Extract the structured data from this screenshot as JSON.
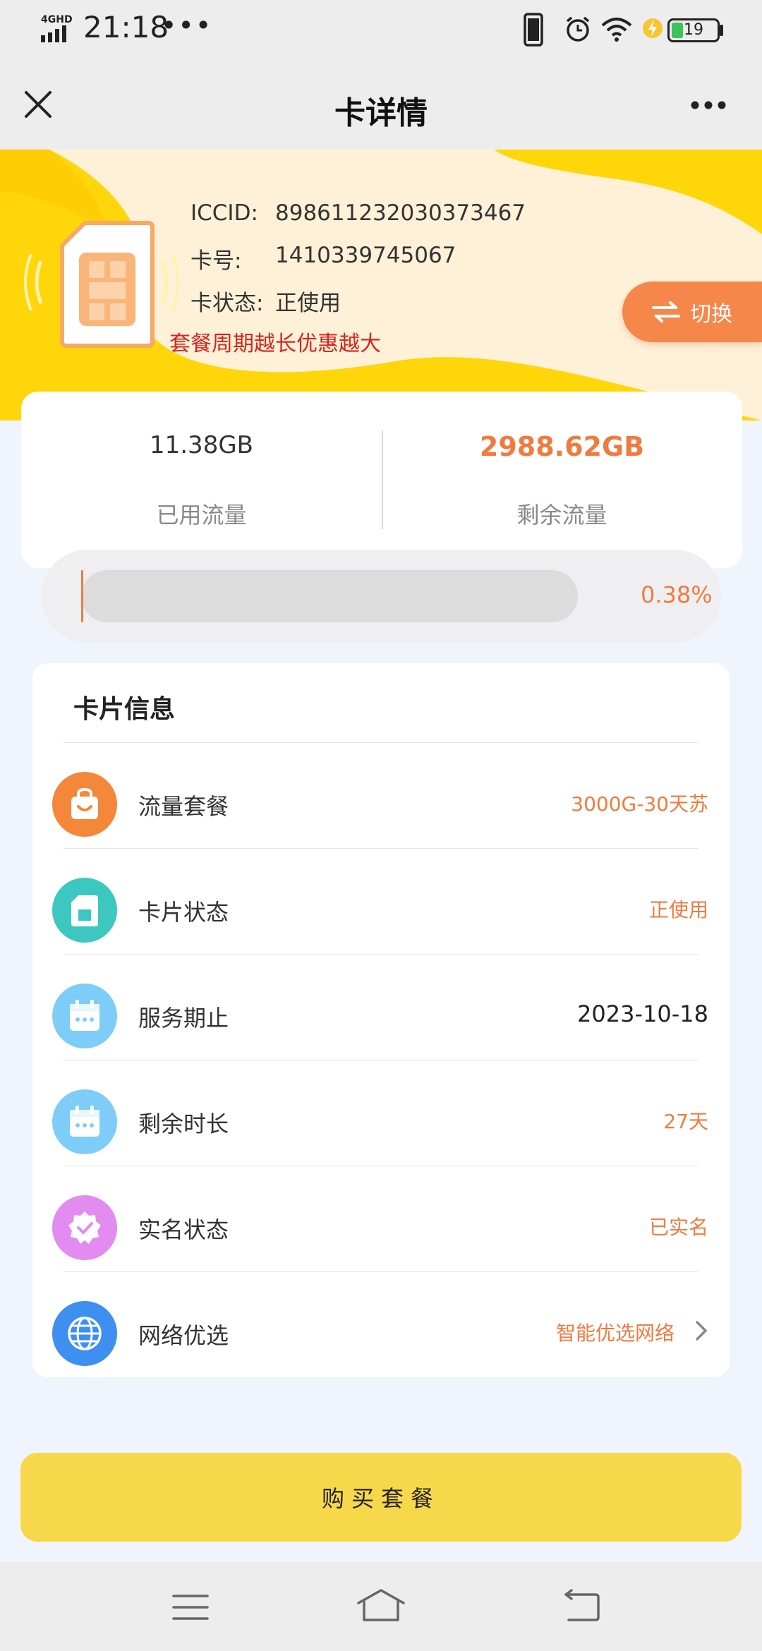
{
  "status_bar": {
    "network": "4GHD",
    "time": "21:18",
    "more": "•••",
    "battery": "19"
  },
  "nav": {
    "title": "卡详情"
  },
  "card": {
    "iccid_label": "ICCID:",
    "iccid": "898611232030373467",
    "number_label": "卡号:",
    "number": "1410339745067",
    "status_label": "卡状态:",
    "status": "正使用",
    "promo": "套餐周期越长优惠越大",
    "switch_label": "切换"
  },
  "usage": {
    "used_value": "11.38GB",
    "used_label": "已用流量",
    "remaining_value": "2988.62GB",
    "remaining_label": "剩余流量",
    "percent_text": "0.38%",
    "percent_fraction": 0.0038
  },
  "info": {
    "title": "卡片信息",
    "rows": [
      {
        "label": "流量套餐",
        "value": "3000G-30天苏",
        "icon": "shopping-bag-icon",
        "color": "#f5873a"
      },
      {
        "label": "卡片状态",
        "value": "正使用",
        "icon": "sim-card-icon",
        "color": "#3cc7c0"
      },
      {
        "label": "服务期止",
        "value": "2023-10-18",
        "icon": "calendar-icon",
        "color": "#7ecdf8"
      },
      {
        "label": "剩余时长",
        "value": "27天",
        "icon": "calendar-icon",
        "color": "#7ecdf8"
      },
      {
        "label": "实名状态",
        "value": "已实名",
        "icon": "verified-badge-icon",
        "color": "#e28bf0"
      },
      {
        "label": "网络优选",
        "value": "智能优选网络",
        "icon": "globe-icon",
        "color": "#3d8ff0"
      }
    ]
  },
  "buy_button": "购买套餐",
  "colors": {
    "accent": "#f07b3f",
    "promo": "#d9231d",
    "buy": "#f8d84b",
    "banner_yellow": "#ffd500"
  }
}
